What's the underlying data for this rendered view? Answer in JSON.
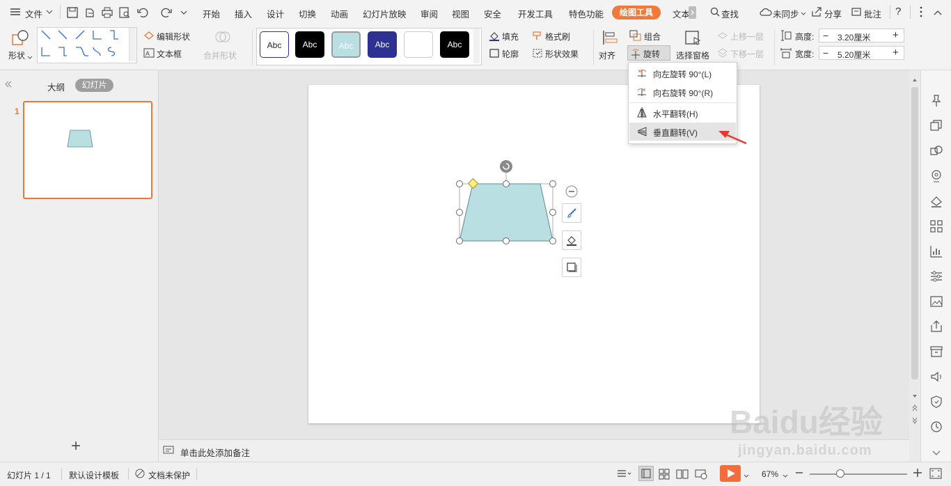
{
  "menubar": {
    "file_label": "文件",
    "tabs": [
      "开始",
      "插入",
      "设计",
      "切换",
      "动画",
      "幻灯片放映",
      "审阅",
      "视图",
      "安全",
      "开发工具",
      "特色功能"
    ],
    "active_tab": "绘图工具",
    "overflow_tab": "文本",
    "search_label": "查找",
    "sync_label": "未同步",
    "share_label": "分享",
    "comment_label": "批注",
    "help_label": "?",
    "colors": {
      "accent": "#f17a3a"
    }
  },
  "ribbon": {
    "shape_label": "形状",
    "edit_shape_label": "编辑形状",
    "textbox_label": "文本框",
    "merge_shapes_label": "合并形状",
    "style_samples": [
      "Abc",
      "Abc",
      "Abc",
      "Abc",
      "",
      "Abc"
    ],
    "fill_label": "填充",
    "format_painter_label": "格式刷",
    "outline_label": "轮廓",
    "shape_effects_label": "形状效果",
    "align_label": "对齐",
    "group_label": "组合",
    "rotate_label": "旋转",
    "selection_pane_label": "选择窗格",
    "bring_forward_label": "上移一层",
    "send_backward_label": "下移一层",
    "height_label": "高度:",
    "height_value": "3.20厘米",
    "width_label": "宽度:",
    "width_value": "5.20厘米",
    "minus": "−",
    "plus": "+"
  },
  "rotate_menu": {
    "items": [
      {
        "label": "向左旋转 90°(L)",
        "icon": "rotate-left-icon"
      },
      {
        "label": "向右旋转 90°(R)",
        "icon": "rotate-right-icon"
      },
      {
        "label": "水平翻转(H)",
        "icon": "flip-horizontal-icon"
      },
      {
        "label": "垂直翻转(V)",
        "icon": "flip-vertical-icon"
      }
    ],
    "highlighted_index": 3
  },
  "left_panel": {
    "outline_tab": "大纲",
    "slides_tab": "幻灯片",
    "slide_number": "1",
    "add_button": "+"
  },
  "notes": {
    "placeholder": "单击此处添加备注"
  },
  "statusbar": {
    "slide_info": "幻灯片 1 / 1",
    "template": "默认设计模板",
    "protection": "文档未保护",
    "zoom": "67%"
  },
  "watermark": {
    "logo_text": "Baidu经验",
    "url_text": "jingyan.baidu.com"
  },
  "colors": {
    "shape_fill": "#b9dfe2",
    "shape_stroke": "#5b8a8f",
    "annotation_arrow": "#e53935",
    "slide_border_selected": "#e8793a"
  }
}
